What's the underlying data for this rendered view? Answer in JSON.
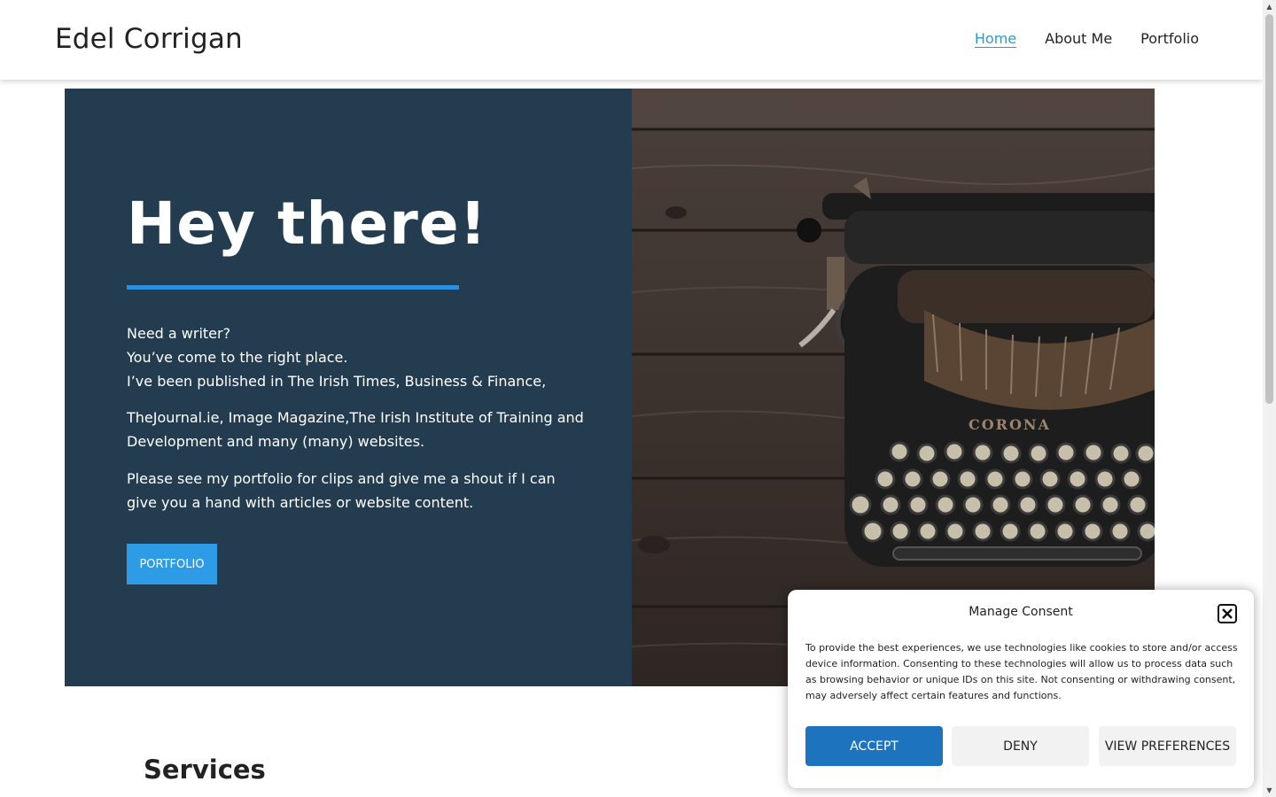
{
  "header": {
    "site_title": "Edel Corrigan",
    "nav": [
      {
        "label": "Home",
        "active": true
      },
      {
        "label": "About Me",
        "active": false
      },
      {
        "label": "Portfolio",
        "active": false
      }
    ]
  },
  "hero": {
    "title": "Hey there!",
    "lines": [
      "Need a writer?",
      "You’ve come to the right place.",
      "I’ve been published in The Irish Times, Business & Finance,"
    ],
    "paragraph2": "TheJournal.ie, Image Magazine,The Irish Institute of Training  and Development and many (many) websites.",
    "paragraph3": "Please see my portfolio for clips and give me a shout if I can give you a hand with articles or website content.",
    "button_label": "PORTFOLIO",
    "panel_color": "#233c50",
    "accent_color": "#2b8fe0"
  },
  "image": {
    "subject": "vintage typewriter on dark wooden table",
    "brand_text": "CORONA"
  },
  "services": {
    "heading": "Services"
  },
  "consent": {
    "title": "Manage Consent",
    "body": "To provide the best experiences, we use technologies like cookies to store and/or access device information. Consenting to these technologies will allow us to process data such as browsing behavior or unique IDs on this site. Not consenting or withdrawing consent, may adversely affect certain features and functions.",
    "accept_label": "ACCEPT",
    "deny_label": "DENY",
    "preferences_label": "VIEW PREFERENCES",
    "accept_color": "#1e73be"
  },
  "icons": {
    "close": "close-icon"
  }
}
